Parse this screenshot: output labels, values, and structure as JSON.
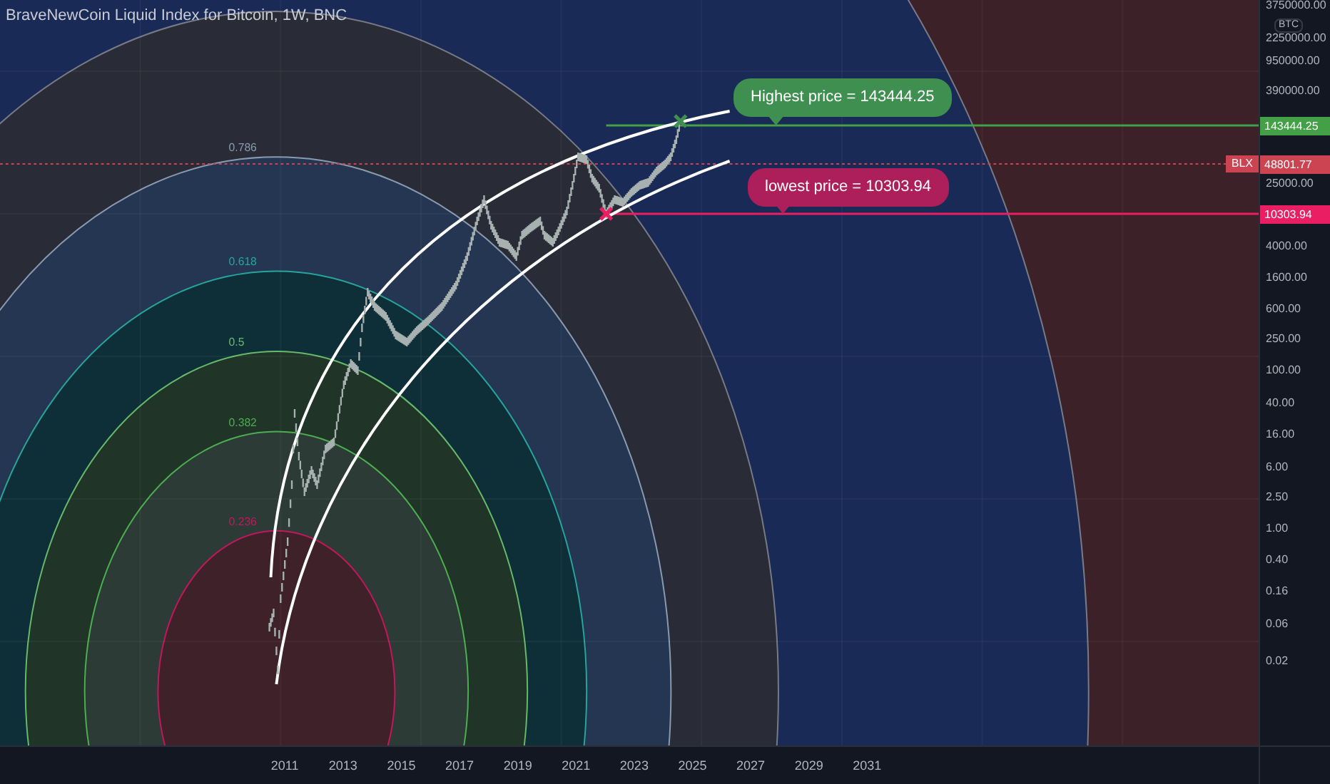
{
  "chart": {
    "title": "BraveNewCoin Liquid Index for Bitcoin, 1W, BNC",
    "fib_levels": [
      {
        "label": "0.786",
        "color": "#8a9bb0"
      },
      {
        "label": "0.618",
        "color": "#26a69a"
      },
      {
        "label": "0.5",
        "color": "#66bb6a"
      },
      {
        "label": "0.382",
        "color": "#4caf50"
      },
      {
        "label": "0.236",
        "color": "#c2185b"
      }
    ],
    "callouts": [
      {
        "text": "Highest price = 143444.25",
        "color": "#3f8f50"
      },
      {
        "text": "lowest price = 10303.94",
        "color": "#ad1f5a"
      }
    ]
  },
  "price_axis": {
    "unit": "BTC",
    "ticks": [
      "3750000.00",
      "2250000.00",
      "950000.00",
      "390000.00",
      "25000.00",
      "4000.00",
      "1600.00",
      "600.00",
      "250.00",
      "100.00",
      "40.00",
      "16.00",
      "6.00",
      "2.50",
      "1.00",
      "0.40",
      "0.16",
      "0.06",
      "0.02"
    ],
    "price_lines": [
      {
        "label": "143444.25",
        "color": "#43a047"
      },
      {
        "symbol": "BLX",
        "label": "48801.77",
        "color": "#cc4452"
      },
      {
        "label": "10303.94",
        "color": "#e91e63"
      }
    ]
  },
  "time_axis": {
    "ticks": [
      "2011",
      "2013",
      "2015",
      "2017",
      "2019",
      "2021",
      "2023",
      "2025",
      "2027",
      "2029",
      "2031"
    ]
  }
}
